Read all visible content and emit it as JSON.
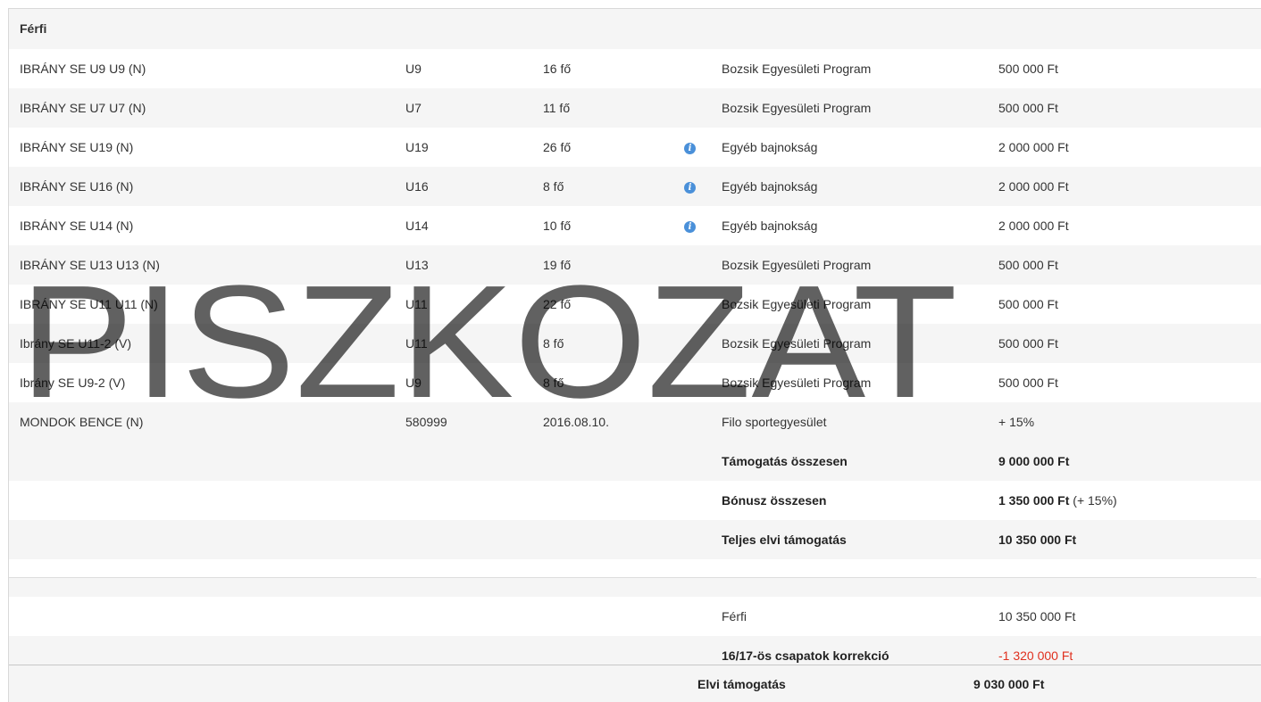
{
  "section": {
    "title": "Férfi"
  },
  "teams": [
    {
      "name": "IBRÁNY SE U9 U9 (N)",
      "age": "U9",
      "count": "16 fő",
      "info": false,
      "program": "Bozsik Egyesületi Program",
      "amount": "500 000 Ft"
    },
    {
      "name": "IBRÁNY SE U7 U7 (N)",
      "age": "U7",
      "count": "11 fő",
      "info": false,
      "program": "Bozsik Egyesületi Program",
      "amount": "500 000 Ft"
    },
    {
      "name": "IBRÁNY SE U19 (N)",
      "age": "U19",
      "count": "26 fő",
      "info": true,
      "program": "Egyéb bajnokság",
      "amount": "2 000 000 Ft"
    },
    {
      "name": "IBRÁNY SE U16 (N)",
      "age": "U16",
      "count": "8 fő",
      "info": true,
      "program": "Egyéb bajnokság",
      "amount": "2 000 000 Ft"
    },
    {
      "name": "IBRÁNY SE U14 (N)",
      "age": "U14",
      "count": "10 fő",
      "info": true,
      "program": "Egyéb bajnokság",
      "amount": "2 000 000 Ft"
    },
    {
      "name": "IBRÁNY SE U13 U13 (N)",
      "age": "U13",
      "count": "19 fő",
      "info": false,
      "program": "Bozsik Egyesületi Program",
      "amount": "500 000 Ft"
    },
    {
      "name": "IBRÁNY SE U11 U11 (N)",
      "age": "U11",
      "count": "22 fő",
      "info": false,
      "program": "Bozsik Egyesületi Program",
      "amount": "500 000 Ft"
    },
    {
      "name": "Ibrány SE U11-2 (V)",
      "age": "U11",
      "count": "8 fő",
      "info": false,
      "program": "Bozsik Egyesületi Program",
      "amount": "500 000 Ft"
    },
    {
      "name": "Ibrány SE U9-2 (V)",
      "age": "U9",
      "count": "8 fő",
      "info": false,
      "program": "Bozsik Egyesületi Program",
      "amount": "500 000 Ft"
    },
    {
      "name": "MONDOK BENCE (N)",
      "age": "580999",
      "count": "2016.08.10.",
      "info": false,
      "program": "Filo sportegyesület",
      "amount": "+ 15%"
    }
  ],
  "info_icon": "info-circle-icon",
  "summary": {
    "support_label": "Támogatás összesen",
    "support_value": "9 000 000 Ft",
    "bonus_label": "Bónusz összesen",
    "bonus_value": "1 350 000 Ft",
    "bonus_note": "(+ 15%)",
    "full_label": "Teljes elvi támogatás",
    "full_value": "10 350 000 Ft"
  },
  "correction": {
    "category_label": "Férfi",
    "category_value": "10 350 000 Ft",
    "correction_label": "16/17-ös csapatok korrekció",
    "correction_value": "-1 320 000 Ft"
  },
  "total": {
    "label": "Elvi támogatás",
    "value": "9 030 000 Ft"
  },
  "watermark": "PISZKOZAT",
  "colors": {
    "info": "#4a90d9",
    "negative": "#e0301e",
    "row_alt": "#f5f5f5"
  }
}
